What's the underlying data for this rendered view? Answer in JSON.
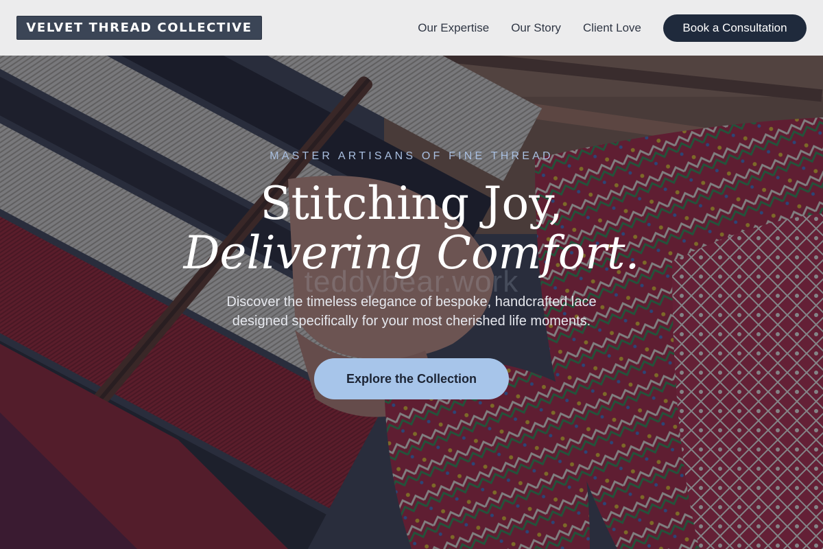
{
  "brand": {
    "name": "VELVET THREAD COLLECTIVE"
  },
  "nav": {
    "links": [
      "Our Expertise",
      "Our Story",
      "Client Love"
    ],
    "cta": "Book a Consultation"
  },
  "hero": {
    "eyebrow": "MASTER ARTISANS OF FINE THREAD",
    "headline_line1": "Stitching Joy,",
    "headline_line2": "Delivering Comfort.",
    "subtext_line1": "Discover the timeless elegance of bespoke, handcrafted lace",
    "subtext_line2": "designed specifically for your most cherished life moments.",
    "cta": "Explore the Collection",
    "watermark": "teddybear.work",
    "background": "woven-textile-loom-image"
  },
  "colors": {
    "header_bg": "#ececed",
    "logo_bg": "#3b4556",
    "nav_cta_bg": "#1f2a3c",
    "hero_cta_bg": "#a7c5ea",
    "eyebrow": "#a9bfe0"
  }
}
